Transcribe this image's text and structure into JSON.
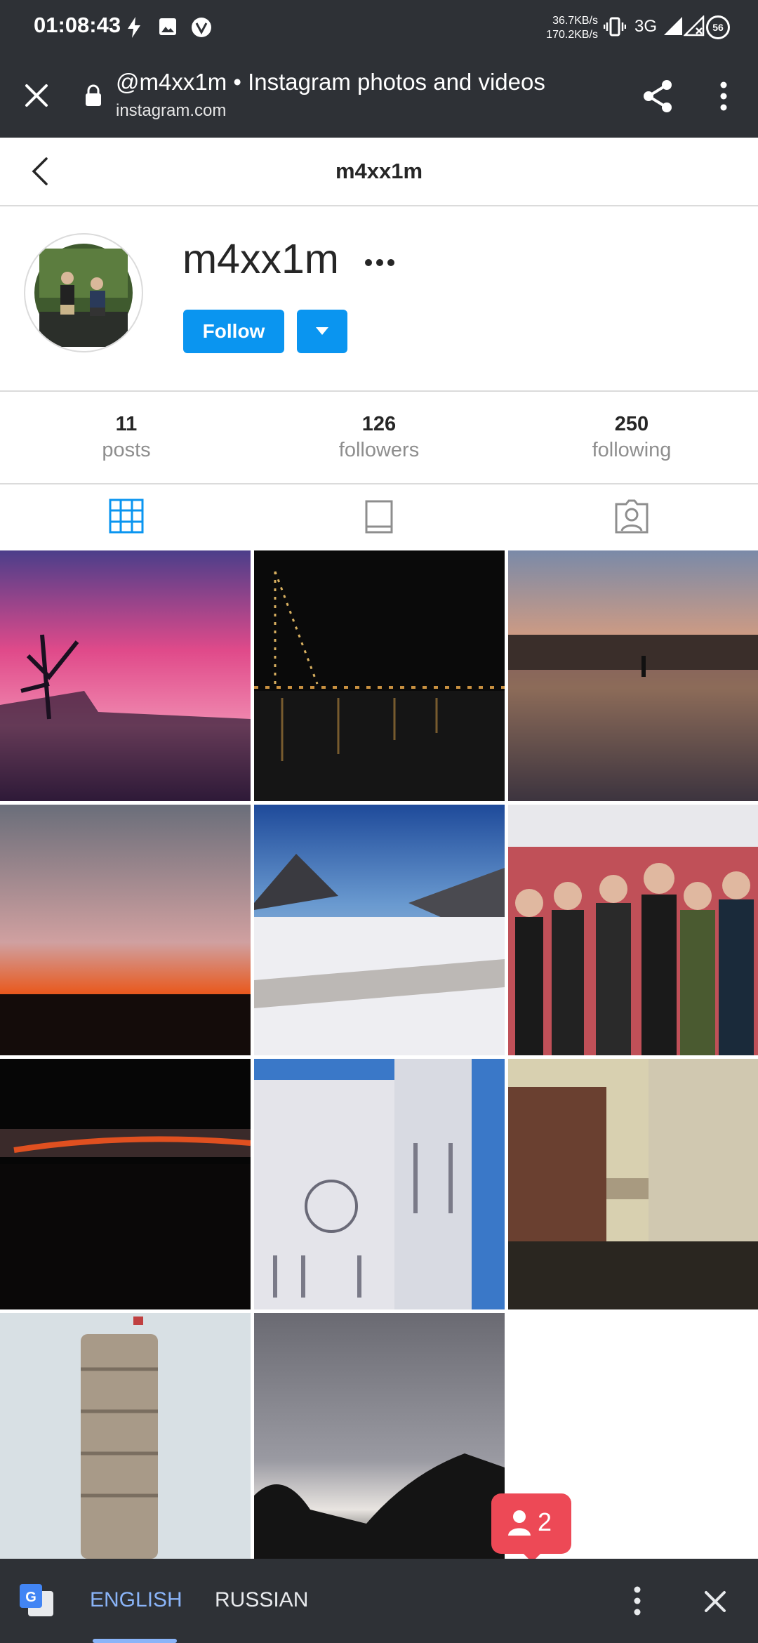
{
  "status_bar": {
    "time": "01:08:43",
    "speed_up": "36.7KB/s",
    "speed_down": "170.2KB/s",
    "network": "3G",
    "battery": "56"
  },
  "browser": {
    "page_title": "@m4xx1m • Instagram photos and videos",
    "domain": "instagram.com"
  },
  "header": {
    "username": "m4xx1m"
  },
  "profile": {
    "username": "m4xx1m",
    "follow_label": "Follow"
  },
  "stats": [
    {
      "value": "11",
      "label": "posts"
    },
    {
      "value": "126",
      "label": "followers"
    },
    {
      "value": "250",
      "label": "following"
    }
  ],
  "tabs": [
    "grid-icon",
    "feed-icon",
    "tagged-icon"
  ],
  "chat_badge": {
    "count": "2"
  },
  "translate_bar": {
    "lang_active": "ENGLISH",
    "lang_other": "RUSSIAN"
  },
  "colors": {
    "accent": "#0a95f0",
    "badge": "#ed4956",
    "chrome": "#2e3136"
  }
}
